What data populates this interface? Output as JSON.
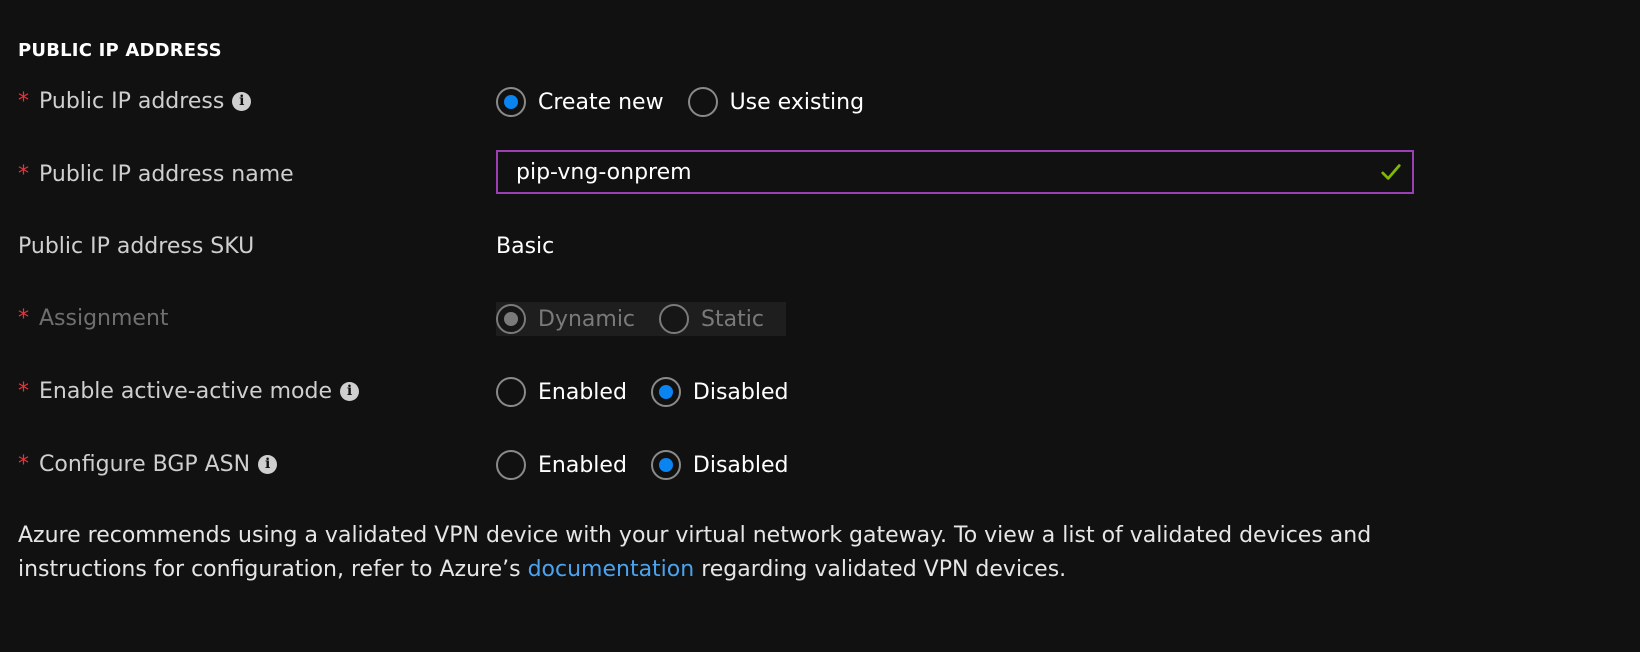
{
  "section": {
    "title": "PUBLIC IP ADDRESS"
  },
  "colors": {
    "background": "#111111",
    "accent": "#0a84f0",
    "required": "#e8333a",
    "input_border": "#9b3fb5",
    "valid_check": "#7fba00",
    "link": "#4aa3f0"
  },
  "fields": {
    "public_ip": {
      "required": "*",
      "label": "Public IP address",
      "icon": "info-icon",
      "options": [
        "Create new",
        "Use existing"
      ],
      "selected": "Create new"
    },
    "public_ip_name": {
      "required": "*",
      "label": "Public IP address name",
      "value": "pip-vng-onprem",
      "status_icon": "check-icon"
    },
    "sku": {
      "label": "Public IP address SKU",
      "value": "Basic"
    },
    "assignment": {
      "required": "*",
      "label": "Assignment",
      "options": [
        "Dynamic",
        "Static"
      ],
      "selected": "Dynamic",
      "disabled": true
    },
    "active_active": {
      "required": "*",
      "label": "Enable active-active mode",
      "icon": "info-icon",
      "options": [
        "Enabled",
        "Disabled"
      ],
      "selected": "Disabled"
    },
    "bgp_asn": {
      "required": "*",
      "label": "Configure BGP ASN",
      "icon": "info-icon",
      "options": [
        "Enabled",
        "Disabled"
      ],
      "selected": "Disabled"
    }
  },
  "note": {
    "text_before": "Azure recommends using a validated VPN device with your virtual network gateway. To view a list of validated devices and instructions for configuration, refer to Azure’s ",
    "link_text": "documentation",
    "text_after": " regarding validated VPN devices."
  }
}
